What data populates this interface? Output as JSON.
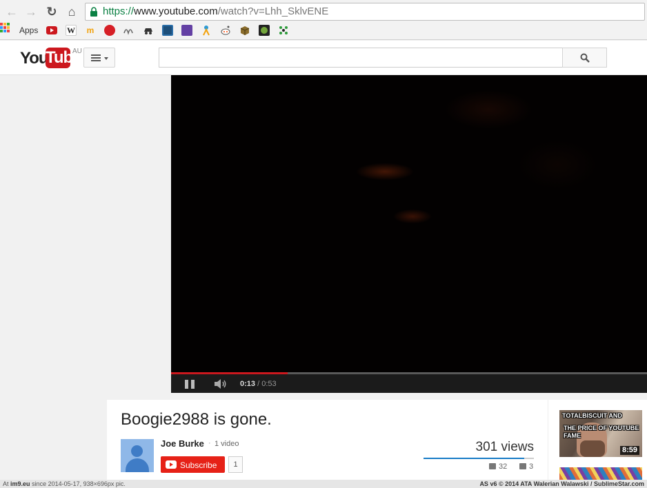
{
  "browser": {
    "url_scheme": "https://",
    "url_host": "www.youtube.com",
    "url_path": "/watch?v=Lhh_SklvENE",
    "apps_label": "Apps",
    "bookmark_colors": [
      "#cc181e",
      "#ffffff",
      "#f2a20c",
      "#d61f26",
      "#666666",
      "#333333",
      "#2b6ea8",
      "#6441a4",
      "#2d9ad3",
      "#ff4500",
      "#8b6d2c",
      "#72a53a",
      "#2e9c3b"
    ]
  },
  "header": {
    "logo_you": "You",
    "logo_tube": "Tube",
    "logo_region": "AU",
    "search_placeholder": ""
  },
  "player": {
    "progress_fraction": 0.245,
    "current_time": "0:13",
    "duration": "/ 0:53"
  },
  "video": {
    "title": "Boogie2988 is gone.",
    "channel": "Joe Burke",
    "separator": "·",
    "video_count": "1 video",
    "subscribe_label": "Subscribe",
    "subscriber_count": "1",
    "views": "301 views",
    "likes": "32",
    "dislikes": "3",
    "like_fraction": 0.914
  },
  "sidebar": {
    "items": [
      {
        "thumb_line1": "TotalBiscuit and",
        "thumb_line2": "the price of YouTube fame",
        "duration": "8:59"
      }
    ]
  },
  "watermark": {
    "left_prefix": "At",
    "left_site": "im9.eu",
    "left_rest": "since 2014-05-17, 938×696px pic.",
    "right": "AS v6 © 2014 ATA Walerian Walawski / SublimeStar.com"
  }
}
